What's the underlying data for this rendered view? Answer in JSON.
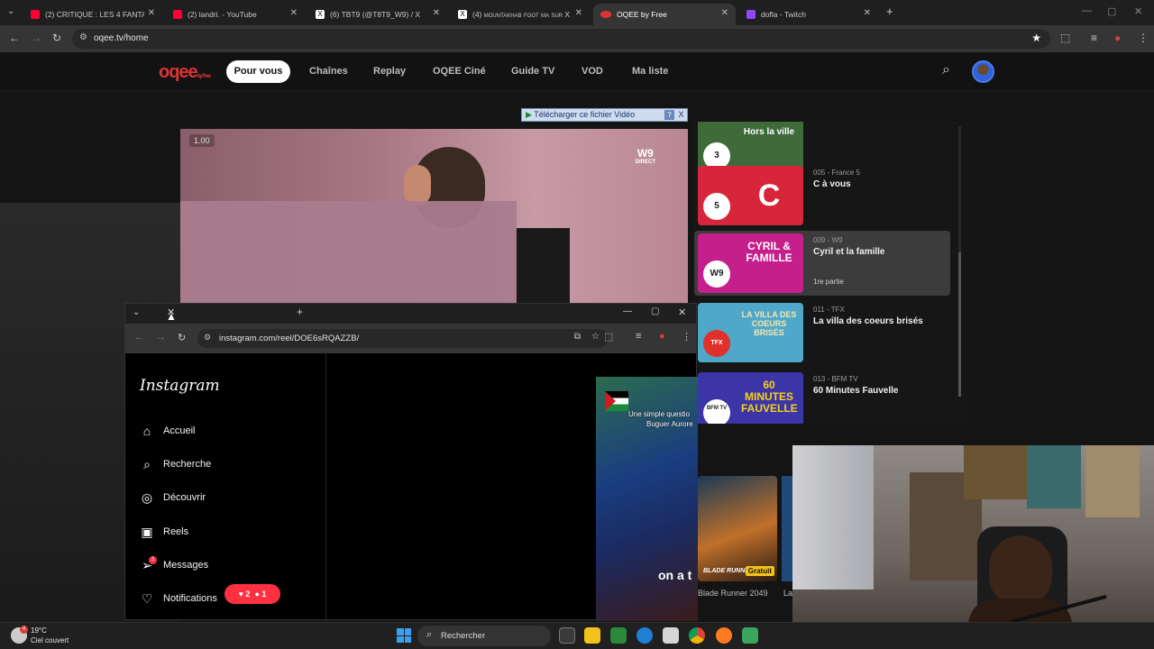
{
  "browser": {
    "tabs": [
      {
        "title": "(2) CRITIQUE : LES 4 FANTASTIQ",
        "color": "#ff0033"
      },
      {
        "title": "(2) landri. - YouTube",
        "color": "#ff0033"
      },
      {
        "title": "(6) TBT9 (@T8T9_W9) / X",
        "color": "#ffffff"
      },
      {
        "title": "(4) mountakhab foot ma sur X :",
        "color": "#ffffff"
      },
      {
        "title": "OQEE by Free",
        "color": "#e03232"
      },
      {
        "title": "dofla - Twitch",
        "color": "#9146ff"
      }
    ],
    "new_tab": "+",
    "url": "oqee.tv/home"
  },
  "oqee": {
    "logo_main": "oqee",
    "logo_sub": "by Free",
    "nav": {
      "pour_vous": "Pour vous",
      "chaines": "Chaînes",
      "replay": "Replay",
      "cine": "OQEE Ciné",
      "guide": "Guide TV",
      "vod": "VOD",
      "liste": "Ma liste"
    }
  },
  "player": {
    "time": "1.00",
    "channel_logo": "W9",
    "channel_logo_sub": "DIRECT",
    "download_bar": "Télécharger ce fichier Vidéo",
    "help": "?",
    "close": "X"
  },
  "channels": [
    {
      "num": "",
      "name": "",
      "sub": "",
      "thumb_text": "Hors la ville",
      "badge": "3",
      "color": "#3f6a3a"
    },
    {
      "num": "005 - France 5",
      "name": "C à vous",
      "sub": "",
      "thumb_text": "C",
      "badge": "5",
      "color": "#d7263a"
    },
    {
      "num": "009 - W9",
      "name": "Cyril et la famille",
      "sub": "1re partie",
      "thumb_text": "CYRIL & FAMILLE",
      "badge": "W9",
      "color": "#c41f8a"
    },
    {
      "num": "011 - TFX",
      "name": "La villa des coeurs brisés",
      "sub": "",
      "thumb_text": "LA VILLA DES COEURS BRISÉS",
      "badge": "TFX",
      "color": "#4fa8c9"
    },
    {
      "num": "013 - BFM TV",
      "name": "60 Minutes Fauvelle",
      "sub": "",
      "thumb_text": "60 MINUTES FAUVELLE",
      "badge": "BFM TV",
      "color": "#3b35a8"
    }
  ],
  "instagram": {
    "url": "instagram.com/reel/DOE6sRQAZZB/",
    "logo": "Instagram",
    "nav": {
      "accueil": "Accueil",
      "recherche": "Recherche",
      "decouvrir": "Découvrir",
      "reels": "Reels",
      "messages": "Messages",
      "notifications": "Notifications"
    },
    "messages_count": "3",
    "notif_likes": "2",
    "notif_follows": "1",
    "reel_caption_1": "Une simple questio",
    "reel_caption_2": "Buguer Aurore",
    "reel_subtitle": "on a t"
  },
  "movies": [
    {
      "title": "Blade Runner 2049",
      "badge": "Gratuit",
      "logo": "BLADE RUNNER"
    },
    {
      "title": "La",
      "badge": "",
      "logo": ""
    }
  ],
  "taskbar": {
    "temp": "19°C",
    "weather": "Ciel couvert",
    "weather_badge": "4",
    "search": "Rechercher"
  }
}
